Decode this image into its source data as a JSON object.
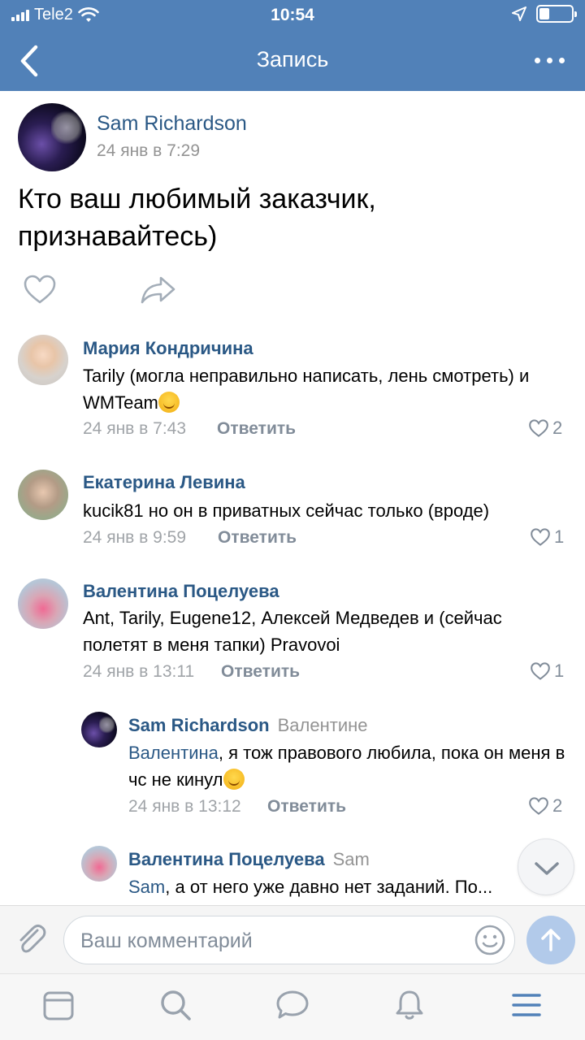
{
  "status_bar": {
    "carrier": "Tele2",
    "time": "10:54"
  },
  "nav": {
    "title": "Запись"
  },
  "post": {
    "author": "Sam Richardson",
    "date": "24 янв в 7:29",
    "text": "Кто ваш любимый заказчик, признавайтесь)"
  },
  "comments": [
    {
      "author": "Мария Кондричина",
      "text": "Tarily (могла неправильно написать, лень смотреть) и WMTeam",
      "date": "24 янв в 7:43",
      "reply_label": "Ответить",
      "likes": "2"
    },
    {
      "author": "Екатерина Левина",
      "text": "kucik81 но он в приватных сейчас только (вроде)",
      "date": "24 янв в 9:59",
      "reply_label": "Ответить",
      "likes": "1"
    },
    {
      "author": "Валентина Поцелуева",
      "text": "Ant, Tarily, Eugene12, Алексей Медведев и (сейчас полетят в меня тапки) Pravovoi",
      "date": "24 янв в 13:11",
      "reply_label": "Ответить",
      "likes": "1"
    }
  ],
  "replies": [
    {
      "author": "Sam Richardson",
      "to": "Валентине",
      "mention": "Валентина",
      "text": ", я тож правового любила, пока он меня в чс не кинул",
      "date": "24 янв в 13:12",
      "reply_label": "Ответить",
      "likes": "2"
    },
    {
      "author": "Валентина Поцелуева",
      "to": "Sam",
      "mention": "Sam",
      "text": ", а от него уже давно нет заданий. По..."
    }
  ],
  "composer": {
    "placeholder": "Ваш комментарий"
  },
  "colors": {
    "header": "#5181b8",
    "link": "#2a5885",
    "muted": "#939393"
  }
}
